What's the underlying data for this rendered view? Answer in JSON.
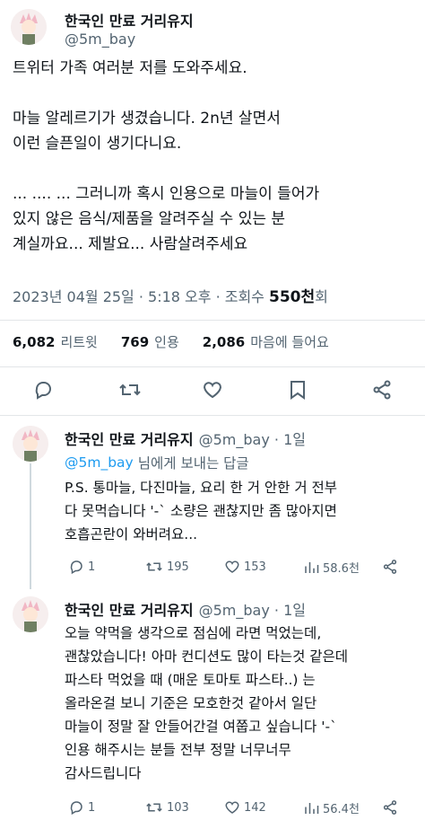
{
  "main_tweet": {
    "author_name": "한국인 만료 거리유지",
    "handle": "@5m_bay",
    "body": "트위터 가족 여러분 저를 도와주세요.\n\n마늘 알레르기가 생겼습니다. 2n년 살면서\n이런 슬픈일이 생기다니요.\n\n... .... ... 그러니까 혹시 인용으로 마늘이 들어가\n있지 않은 음식/제품을 알려주실 수 있는 분\n계실까요... 제발요... 사람살려주세요",
    "date": "2023년 04월 25일 · 5:18 오후 · 조회수",
    "views_value": "550천",
    "views_suffix": "회",
    "stats": {
      "retweets_value": "6,082",
      "retweets_label": "리트윗",
      "quotes_value": "769",
      "quotes_label": "인용",
      "likes_value": "2,086",
      "likes_label": "마음에 들어요"
    }
  },
  "replies": [
    {
      "author_name": "한국인 만료 거리유지",
      "handle_time": "@5m_bay · 1일",
      "reply_to_mention": "@5m_bay",
      "reply_to_suffix": "님에게 보내는 답글",
      "body": "P.S. 통마늘, 다진마늘, 요리 한 거 안한 거 전부\n다 못먹습니다 '-` 소량은 괜찮지만 좀 많아지면\n호흡곤란이 와버려요...",
      "stats": {
        "replies": "1",
        "retweets": "195",
        "likes": "153",
        "views": "58.6천"
      }
    },
    {
      "author_name": "한국인 만료 거리유지",
      "handle_time": "@5m_bay · 1일",
      "body": "오늘 약먹을 생각으로 점심에 라면 먹었는데,\n괜찮았습니다! 아마 컨디션도 많이 타는것 같은데\n파스타 먹었을 때 (매운 토마토 파스타..) 는\n올라온걸 보니 기준은 모호한것 같아서 일단\n마늘이 정말 잘 안들어간걸 여쭙고 싶습니다 '-`\n인용 해주시는 분들 전부 정말 너무너무\n감사드립니다",
      "stats": {
        "replies": "1",
        "retweets": "103",
        "likes": "142",
        "views": "56.4천"
      }
    }
  ],
  "icons": {
    "reply": "reply-icon",
    "retweet": "retweet-icon",
    "like": "heart-icon",
    "bookmark": "bookmark-icon",
    "share": "share-icon",
    "views": "views-icon"
  },
  "colors": {
    "text": "#0f1419",
    "muted": "#536471",
    "link": "#1d9bf0",
    "divider": "#e3e6e8"
  }
}
